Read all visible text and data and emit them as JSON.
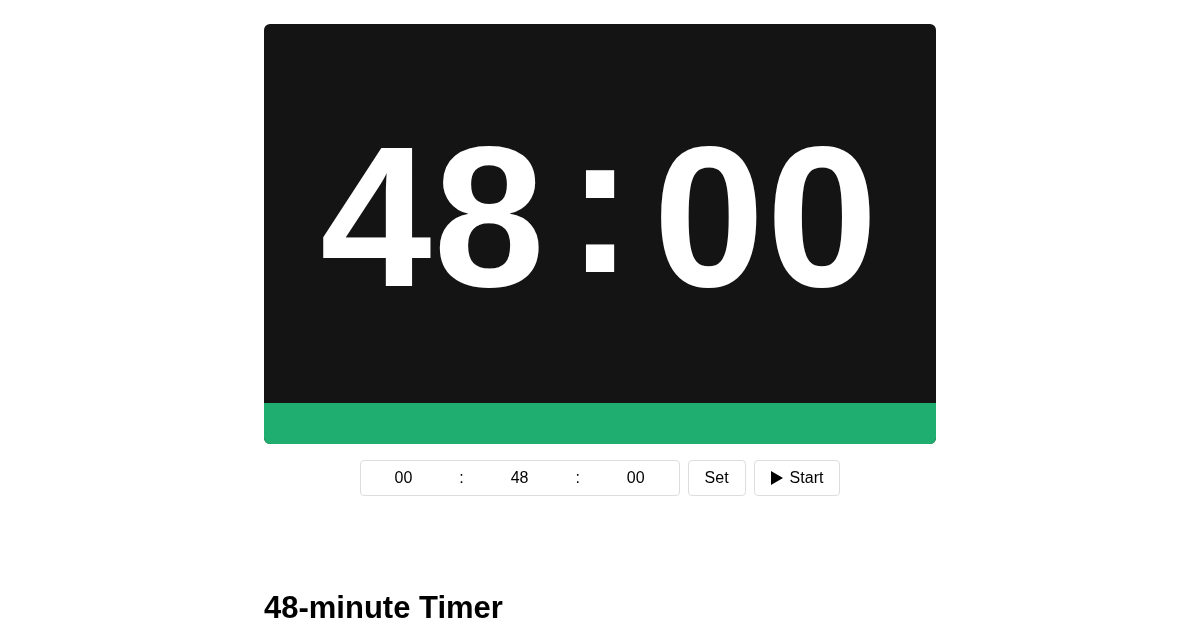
{
  "display": {
    "minutes": "48",
    "separator": ":",
    "seconds": "00"
  },
  "progress": {
    "level": 1
  },
  "time_input": {
    "fields": [
      "00",
      "48",
      "00"
    ],
    "separators": [
      ":",
      ":"
    ]
  },
  "buttons": [
    {
      "kind": "set",
      "label": "Set"
    },
    {
      "kind": "start",
      "label": "Start"
    }
  ],
  "heading": "48-minute Timer"
}
